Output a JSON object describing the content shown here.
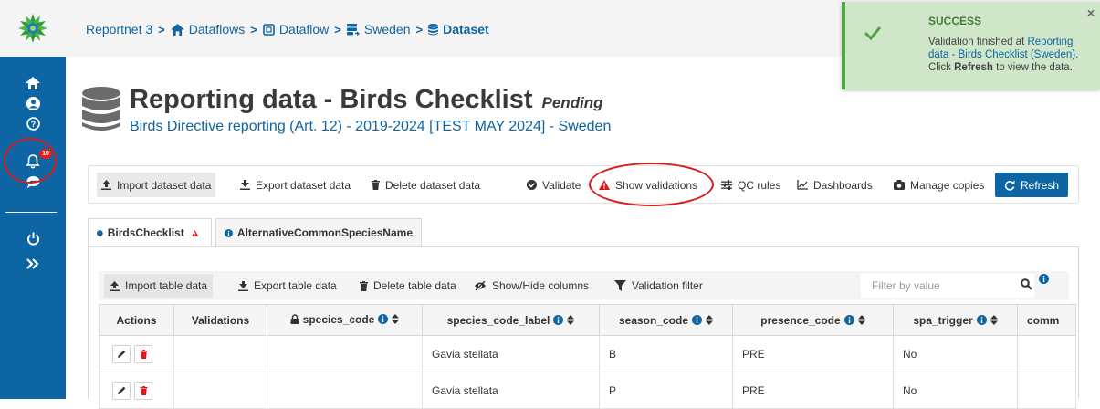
{
  "breadcrumbs": [
    {
      "label": "Reportnet 3",
      "icon": ""
    },
    {
      "label": "Dataflows",
      "icon": "home-icon"
    },
    {
      "label": "Dataflow",
      "icon": "clone-icon"
    },
    {
      "label": "Sweden",
      "icon": "server-icon"
    },
    {
      "label": "Dataset",
      "icon": "database-icon"
    }
  ],
  "sidebar": {
    "icons": [
      "home-icon",
      "user-icon",
      "help-icon",
      "bell-icon",
      "comment-icon",
      "power-icon",
      "expand-icon"
    ],
    "notification_count": "10"
  },
  "toast": {
    "title": "SUCCESS",
    "msg_prefix": "Validation finished at ",
    "msg_link": "Reporting data - Birds Checklist (Sweden).",
    "msg_click": "Click ",
    "msg_refresh": "Refresh",
    "msg_suffix": " to view the data.",
    "close": "×"
  },
  "header": {
    "title": "Reporting data - Birds Checklist",
    "status": "Pending",
    "subtitle": "Birds Directive reporting (Art. 12) - 2019-2024 [TEST MAY 2024] - Sweden"
  },
  "toolbar": {
    "import": "Import dataset data",
    "export": "Export dataset data",
    "delete": "Delete dataset data",
    "validate": "Validate",
    "show_validations": "Show validations",
    "qc_rules": "QC rules",
    "dashboards": "Dashboards",
    "manage_copies": "Manage copies",
    "refresh": "Refresh"
  },
  "tabs": [
    {
      "label": "BirdsChecklist",
      "active": true,
      "has_error": true
    },
    {
      "label": "AlternativeCommonSpeciesName",
      "active": false,
      "has_error": false
    }
  ],
  "table_toolbar": {
    "import": "Import table data",
    "export": "Export table data",
    "delete": "Delete table data",
    "show_hide": "Show/Hide columns",
    "validation_filter": "Validation filter",
    "filter_placeholder": "Filter by value"
  },
  "table": {
    "columns": [
      "Actions",
      "Validations",
      "species_code",
      "species_code_label",
      "season_code",
      "presence_code",
      "spa_trigger",
      "comm"
    ],
    "rows": [
      {
        "validations": "",
        "species_code": "",
        "species_code_label": "Gavia stellata",
        "season_code": "B",
        "presence_code": "PRE",
        "spa_trigger": "No",
        "comm": ""
      },
      {
        "validations": "",
        "species_code": "",
        "species_code_label": "Gavia stellata",
        "season_code": "P",
        "presence_code": "PRE",
        "spa_trigger": "No",
        "comm": ""
      }
    ]
  },
  "colors": {
    "primary": "#0d65a4",
    "success_bg": "#cfe6c9",
    "success_accent": "#52a447",
    "error": "#d81c1c"
  }
}
